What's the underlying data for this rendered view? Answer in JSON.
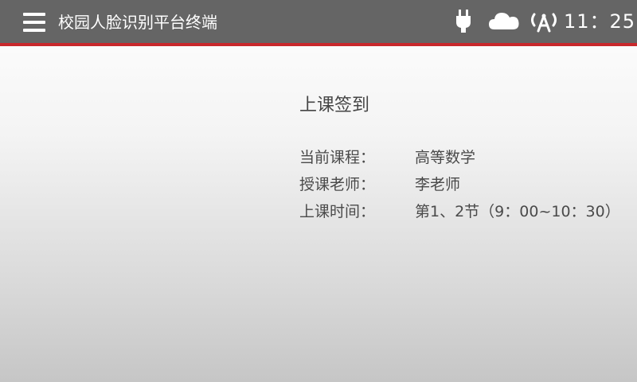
{
  "header": {
    "title": "校园人脸识别平台终端",
    "time": "11：25",
    "icons": [
      "menu-icon",
      "power-plug-icon",
      "cloud-icon",
      "wireless-antenna-icon"
    ],
    "bar_color": "#656565",
    "accent_color": "#c8282c"
  },
  "main": {
    "title": "上课签到",
    "rows": [
      {
        "label": "当前课程：",
        "value": "高等数学"
      },
      {
        "label": "授课老师：",
        "value": "李老师"
      },
      {
        "label": "上课时间：",
        "value": "第1、2节（9：00~10：30）"
      }
    ]
  }
}
